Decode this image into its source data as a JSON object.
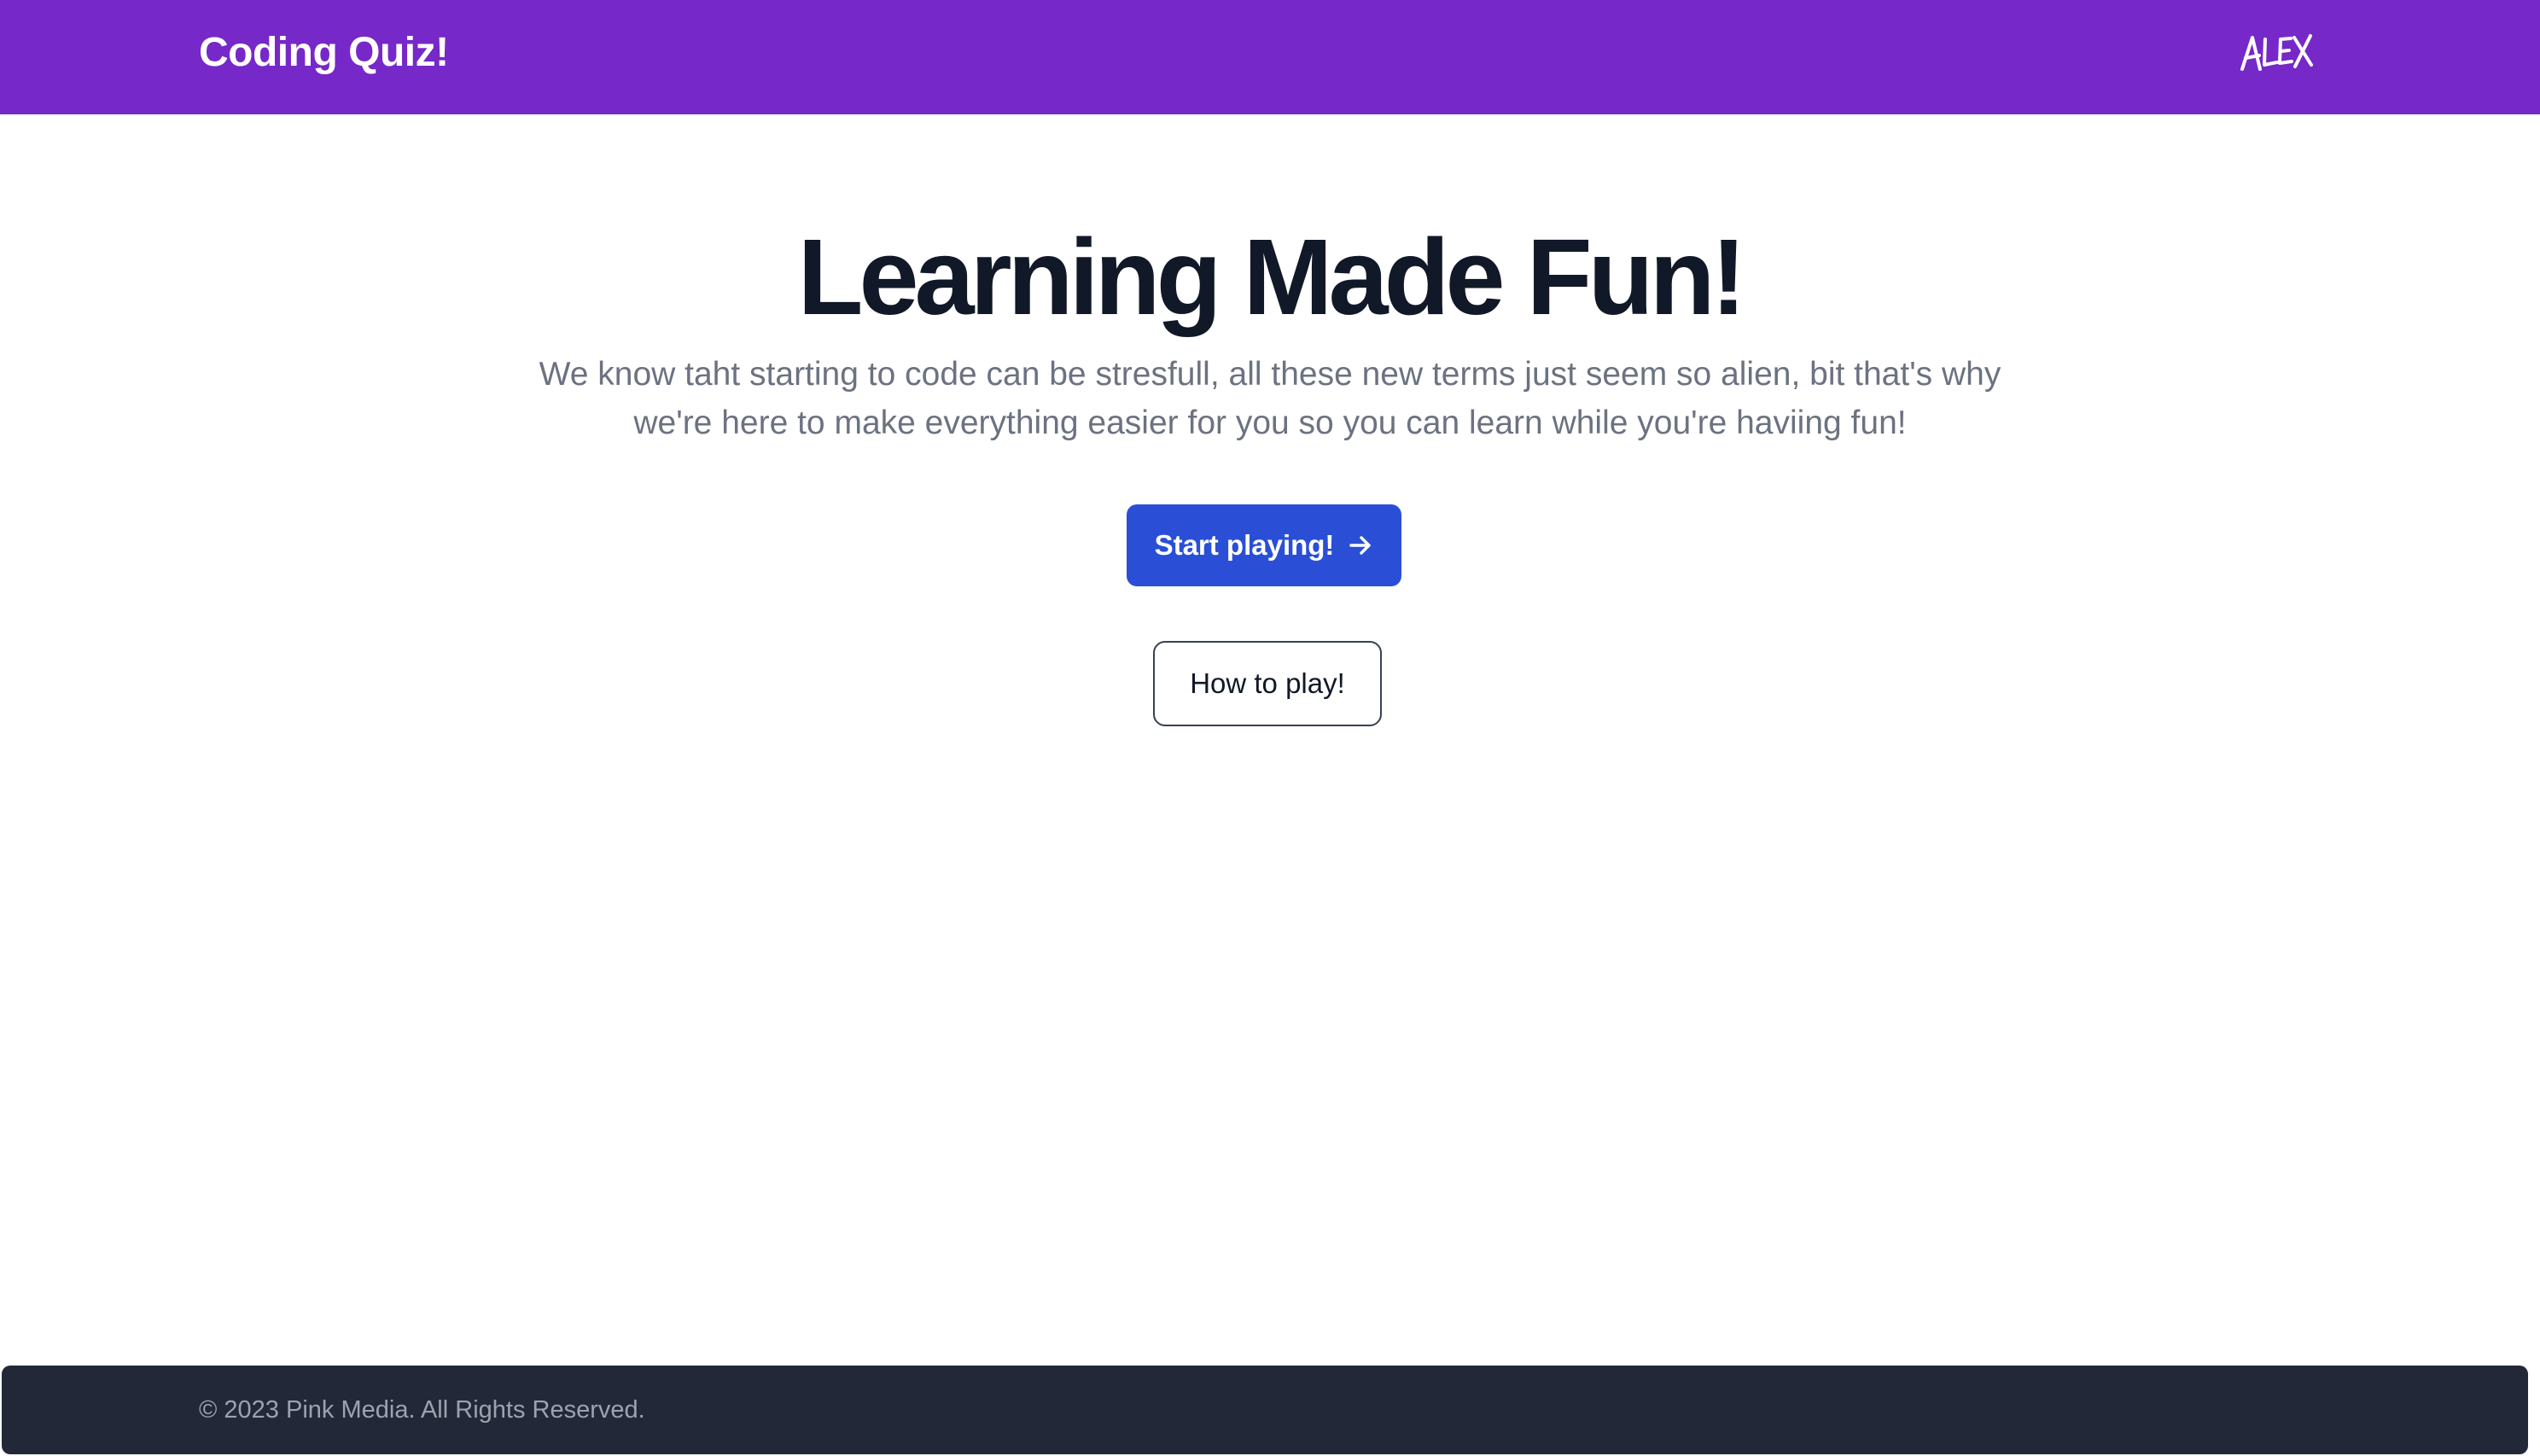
{
  "header": {
    "brand": "Coding Quiz!",
    "logo_text": "ALEX",
    "background_color": "#7628c8"
  },
  "hero": {
    "title": "Learning Made Fun!",
    "description": "We know taht starting to code can be stresfull, all these new terms just seem so alien, bit that's why we're here to make everything easier for you so you can learn while you're haviing fun!",
    "primary_button": {
      "label": "Start playing!",
      "icon": "arrow-right-icon",
      "color": "#2a4fd6"
    },
    "secondary_button": {
      "label": "How to play!"
    }
  },
  "footer": {
    "text": "© 2023 Pink Media. All Rights Reserved.",
    "background_color": "#222838"
  }
}
